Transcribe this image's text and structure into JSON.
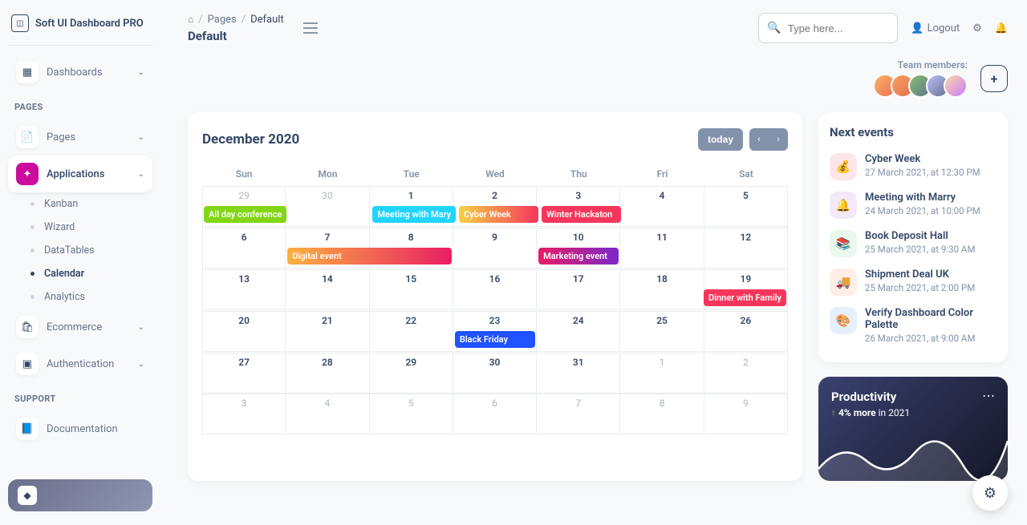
{
  "brand": "Soft UI Dashboard PRO",
  "sidebar": {
    "dashboards": "Dashboards",
    "section_pages": "PAGES",
    "pages": "Pages",
    "applications": "Applications",
    "sub": {
      "kanban": "Kanban",
      "wizard": "Wizard",
      "datatables": "DataTables",
      "calendar": "Calendar",
      "analytics": "Analytics"
    },
    "ecommerce": "Ecommerce",
    "authentication": "Authentication",
    "section_support": "SUPPORT",
    "documentation": "Documentation"
  },
  "breadcrumb": {
    "home_icon": "⌂",
    "pages": "Pages",
    "current": "Default",
    "title": "Default"
  },
  "topbar": {
    "search_placeholder": "Type here...",
    "logout": "Logout"
  },
  "team": {
    "label": "Team members:"
  },
  "calendar": {
    "title": "December 2020",
    "today": "today",
    "days": [
      "Sun",
      "Mon",
      "Tue",
      "Wed",
      "Thu",
      "Fri",
      "Sat"
    ],
    "weeks": [
      [
        {
          "n": "29",
          "o": true
        },
        {
          "n": "30",
          "o": true
        },
        {
          "n": "1"
        },
        {
          "n": "2"
        },
        {
          "n": "3"
        },
        {
          "n": "4"
        },
        {
          "n": "5"
        }
      ],
      [
        {
          "n": "6"
        },
        {
          "n": "7"
        },
        {
          "n": "8"
        },
        {
          "n": "9"
        },
        {
          "n": "10"
        },
        {
          "n": "11"
        },
        {
          "n": "12"
        }
      ],
      [
        {
          "n": "13"
        },
        {
          "n": "14"
        },
        {
          "n": "15"
        },
        {
          "n": "16"
        },
        {
          "n": "17"
        },
        {
          "n": "18"
        },
        {
          "n": "19"
        }
      ],
      [
        {
          "n": "20"
        },
        {
          "n": "21"
        },
        {
          "n": "22"
        },
        {
          "n": "23"
        },
        {
          "n": "24"
        },
        {
          "n": "25"
        },
        {
          "n": "26"
        }
      ],
      [
        {
          "n": "27"
        },
        {
          "n": "28"
        },
        {
          "n": "29"
        },
        {
          "n": "30"
        },
        {
          "n": "31"
        },
        {
          "n": "1",
          "o": true
        },
        {
          "n": "2",
          "o": true
        }
      ],
      [
        {
          "n": "3",
          "o": true
        },
        {
          "n": "4",
          "o": true
        },
        {
          "n": "5",
          "o": true
        },
        {
          "n": "6",
          "o": true
        },
        {
          "n": "7",
          "o": true
        },
        {
          "n": "8",
          "o": true
        },
        {
          "n": "9",
          "o": true
        }
      ]
    ],
    "events": {
      "all_day_conf": "All day conference",
      "meeting_mary": "Meeting with Mary",
      "cyber_week": "Cyber Week",
      "winter_hack": "Winter Hackaton",
      "digital_event": "Digital event",
      "marketing": "Marketing event",
      "dinner": "Dinner with Family",
      "black_friday": "Black Friday"
    }
  },
  "next_events": {
    "title": "Next events",
    "items": [
      {
        "name": "Cyber Week",
        "date": "27 March 2021, at 12:30 PM",
        "icon": "💰",
        "bg": "#fde6ea",
        "color": "#ea0606"
      },
      {
        "name": "Meeting with Marry",
        "date": "24 March 2021, at 10:00 PM",
        "icon": "🔔",
        "bg": "#f3e9fb",
        "color": "#7928ca"
      },
      {
        "name": "Book Deposit Hall",
        "date": "25 March 2021, at 9:30 AM",
        "icon": "📚",
        "bg": "#e9f7ec",
        "color": "#17ad37"
      },
      {
        "name": "Shipment Deal UK",
        "date": "25 March 2021, at 2:00 PM",
        "icon": "🚚",
        "bg": "#fdeee6",
        "color": "#f97316"
      },
      {
        "name": "Verify Dashboard Color Palette",
        "date": "26 March 2021, at 9:00 AM",
        "icon": "🎨",
        "bg": "#e6f0fd",
        "color": "#2152ff"
      }
    ]
  },
  "productivity": {
    "title": "Productivity",
    "percent": "4% more",
    "year": "in 2021"
  }
}
